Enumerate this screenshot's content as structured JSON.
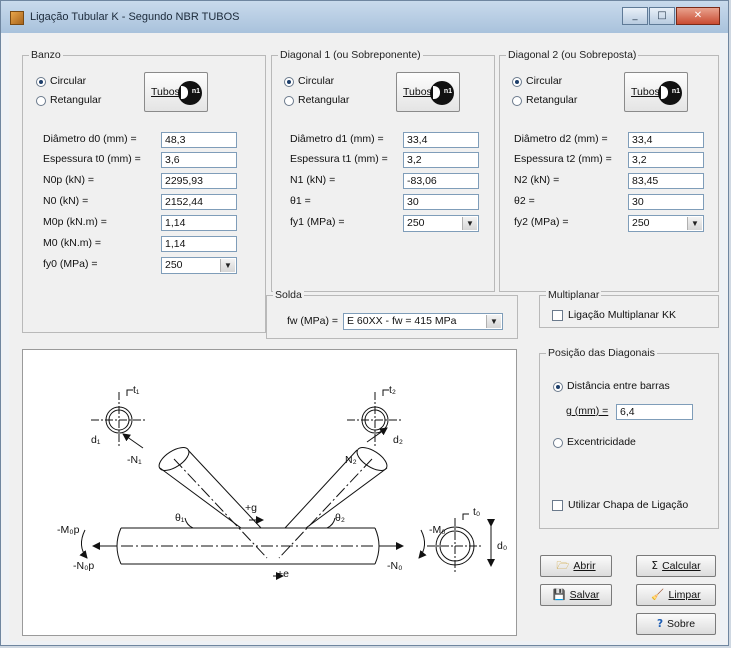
{
  "window": {
    "title": "Ligação Tubular K - Segundo NBR TUBOS",
    "controls": [
      "minimize",
      "maximize",
      "close"
    ]
  },
  "banzo": {
    "title": "Banzo",
    "radio_circular": "Circular",
    "radio_retangular": "Retangular",
    "selected": "Circular",
    "tubos_button": "Tubos",
    "fields": [
      {
        "label": "Diâmetro d0 (mm) =",
        "value": "48,3"
      },
      {
        "label": "Espessura t0 (mm) =",
        "value": "3,6"
      },
      {
        "label": "N0p (kN) =",
        "value": "2295,93"
      },
      {
        "label": "N0 (kN) =",
        "value": "2152,44"
      },
      {
        "label": "M0p (kN.m) =",
        "value": "1,14"
      },
      {
        "label": "M0 (kN.m) =",
        "value": "1,14"
      }
    ],
    "fy_label": "fy0 (MPa) =",
    "fy_value": "250"
  },
  "diagonal1": {
    "title": "Diagonal 1 (ou Sobreponente)",
    "radio_circular": "Circular",
    "radio_retangular": "Retangular",
    "selected": "Circular",
    "tubos_button": "Tubos",
    "fields": [
      {
        "label": "Diâmetro d1 (mm) =",
        "value": "33,4"
      },
      {
        "label": "Espessura t1 (mm) =",
        "value": "3,2"
      },
      {
        "label": "N1 (kN) =",
        "value": "-83,06"
      },
      {
        "label": "θ1 =",
        "value": "30"
      }
    ],
    "fy_label": "fy1 (MPa) =",
    "fy_value": "250"
  },
  "diagonal2": {
    "title": "Diagonal 2 (ou Sobreposta)",
    "radio_circular": "Circular",
    "radio_retangular": "Retangular",
    "selected": "Circular",
    "tubos_button": "Tubos",
    "fields": [
      {
        "label": "Diâmetro d2 (mm) =",
        "value": "33,4"
      },
      {
        "label": "Espessura t2 (mm) =",
        "value": "3,2"
      },
      {
        "label": "N2 (kN) =",
        "value": "83,45"
      },
      {
        "label": "θ2 =",
        "value": "30"
      }
    ],
    "fy_label": "fy2 (MPa) =",
    "fy_value": "250"
  },
  "solda": {
    "title": "Solda",
    "label": "fw (MPa) =",
    "value": "E 60XX - fw = 415 MPa"
  },
  "multiplanar": {
    "title": "Multiplanar",
    "checkbox_label": "Ligação Multiplanar KK",
    "checked": false
  },
  "posicao": {
    "title": "Posição das Diagonais",
    "radio_distancia": "Distância entre barras",
    "g_label": "g (mm) =",
    "g_value": "6,4",
    "radio_excentricidade": "Excentricidade",
    "selected": "Distância entre barras",
    "chapa_label": "Utilizar Chapa de Ligação",
    "chapa_checked": false
  },
  "buttons": {
    "abrir": "Abrir",
    "calcular": "Calcular",
    "salvar": "Salvar",
    "limpar": "Limpar",
    "sobre": "Sobre"
  },
  "diagram": {
    "t1": "t₁",
    "d1": "d₁",
    "n1": "-N₁",
    "t2": "t₂",
    "d2": "d₂",
    "n2": "N₂",
    "theta1": "θ₁",
    "theta2": "θ₂",
    "g": "+g",
    "e": "+e",
    "m0p": "-M₀p",
    "n0p": "-N₀p",
    "m0": "-M₀",
    "n0": "-N₀",
    "t0": "t₀",
    "d0": "d₀"
  },
  "colors": {
    "titlebar": "#b5cbe2",
    "client": "#f0f0f0",
    "close": "#c94b31"
  }
}
